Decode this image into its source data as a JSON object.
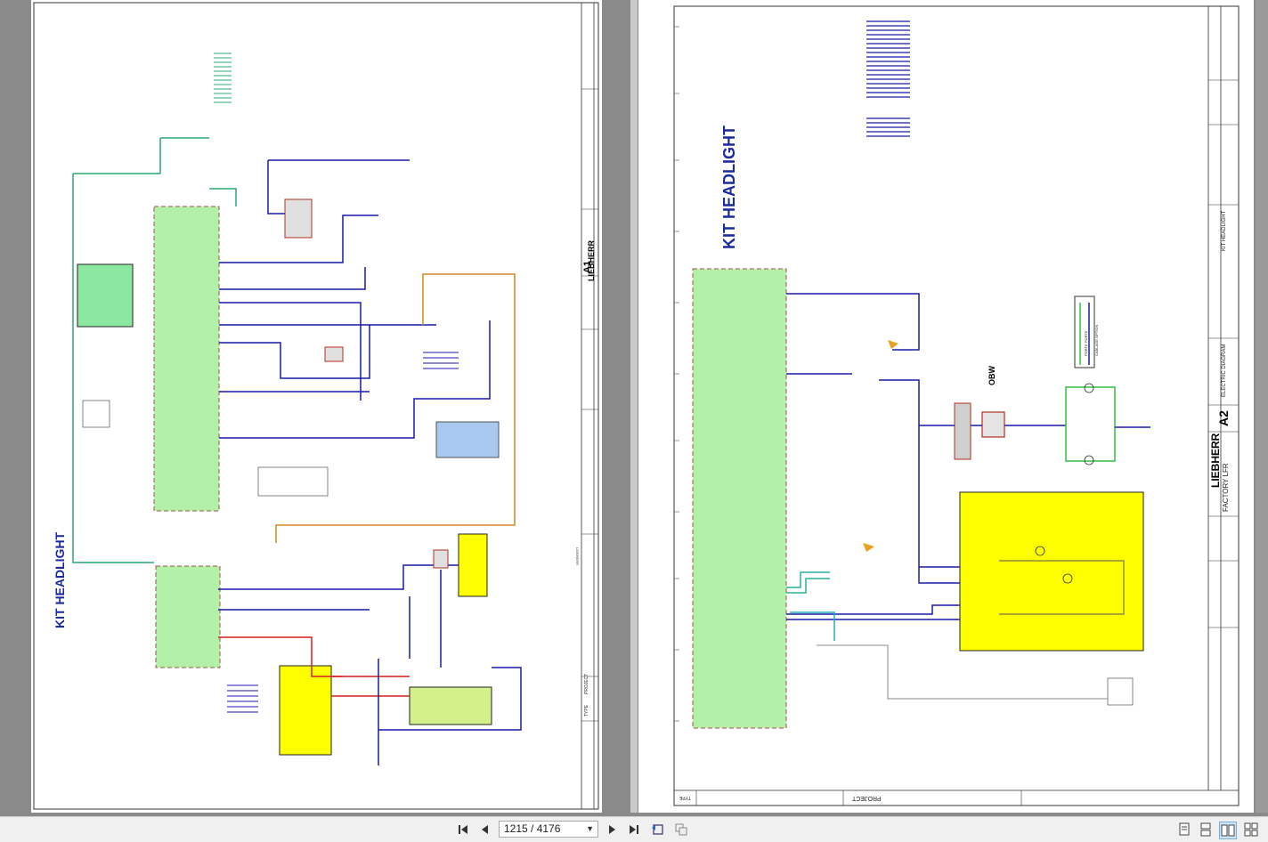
{
  "viewer": {
    "page_indicator": "1215 / 4176"
  },
  "sheet1": {
    "title": "KIT HEADLIGHT",
    "sheet_no": "A1",
    "brand": "LIEBHERR",
    "bottom_labels": [
      "PROJECT",
      "TYPE"
    ]
  },
  "sheet2": {
    "title": "KIT HEADLIGHT",
    "sheet_no": "A2",
    "brand": "LIEBHERR",
    "factory": "FACTORY LFR",
    "designation": "ELECTRIC DIAGRAM",
    "description": "KIT HEADLIGHT",
    "project_label": "PROJECT",
    "type_label": "TYPE",
    "ref_label": "OBW",
    "legend_items": [
      "CABLAGE OPTION",
      "PORTE PORTE"
    ]
  },
  "toolbar": {
    "icons": [
      "first-page-icon",
      "prev-page-icon",
      "next-page-icon",
      "last-page-icon",
      "rotate-icon",
      "copy-icon",
      "single-page-icon",
      "continuous-icon",
      "two-page-icon",
      "two-page-continuous-icon"
    ]
  },
  "colors": {
    "green_zone": "#b3f0a8",
    "yellow_zone": "#ffff00",
    "blue_zone": "#a8c8f0",
    "wire_blue": "#1a1aa8",
    "wire_green": "#22aa55",
    "wire_red": "#d42020",
    "wire_orange": "#d48820",
    "title_blue": "#1a2aa0"
  }
}
